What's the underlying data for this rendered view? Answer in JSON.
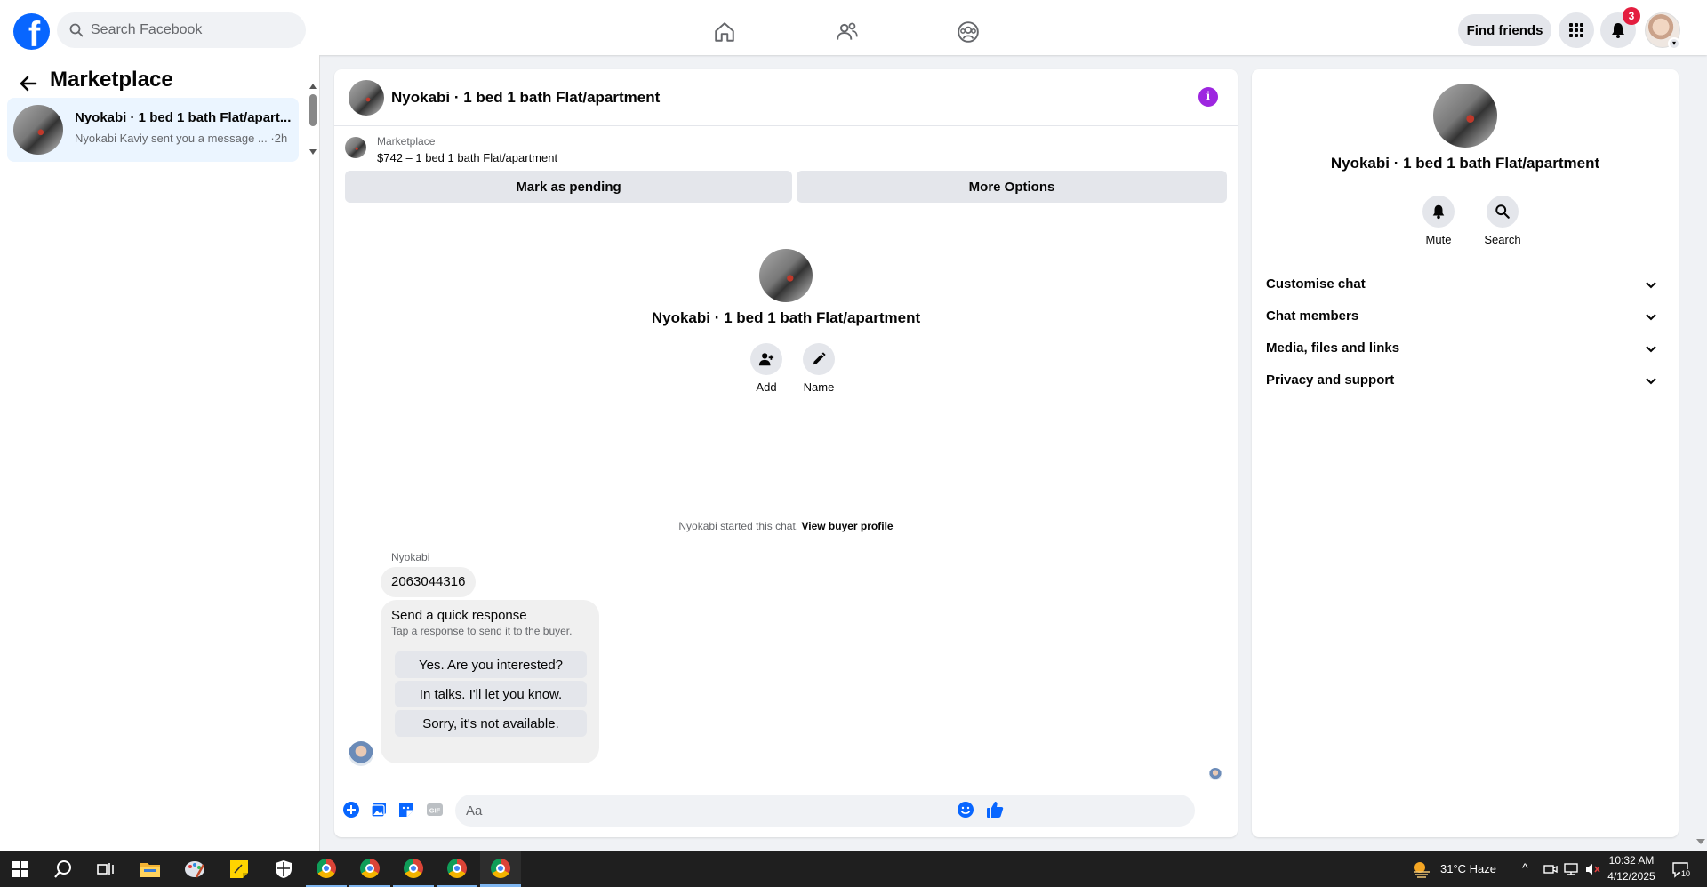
{
  "topbar": {
    "logo": "f",
    "search_placeholder": "Search Facebook",
    "find_friends": "Find friends",
    "notification_count": "3"
  },
  "left": {
    "title": "Marketplace",
    "conversation": {
      "name": "Nyokabi · 1 bed 1 bath Flat/apart...",
      "preview": "Nyokabi Kaviy sent you a message ... ·2h"
    }
  },
  "chat": {
    "header_title": "Nyokabi · 1 bed 1 bath Flat/apartment",
    "listing": {
      "label": "Marketplace",
      "price_line": "$742 – 1 bed 1 bath Flat/apartment"
    },
    "mark_pending": "Mark as pending",
    "more_options": "More Options",
    "center_name": "Nyokabi · 1 bed 1 bath Flat/apartment",
    "actions": {
      "add": "Add",
      "name": "Name"
    },
    "started_text": "Nyokabi started this chat.",
    "view_buyer_profile": "View buyer profile",
    "sender": "Nyokabi",
    "message": "2063044316",
    "quick_response": {
      "title": "Send a quick response",
      "subtitle": "Tap a response to send it to the buyer.",
      "options": [
        "Yes. Are you interested?",
        "In talks. I'll let you know.",
        "Sorry, it's not available."
      ]
    },
    "composer_placeholder": "Aa",
    "gif_label": "GIF"
  },
  "right": {
    "name": "Nyokabi · 1 bed 1 bath Flat/apartment",
    "mute": "Mute",
    "search": "Search",
    "sections": [
      "Customise chat",
      "Chat members",
      "Media, files and links",
      "Privacy and support"
    ]
  },
  "taskbar": {
    "weather": "31°C  Haze",
    "time": "10:32 AM",
    "date": "4/12/2025",
    "notif_count": "10"
  },
  "colors": {
    "facebook_blue": "#0866ff",
    "info_purple": "#9d26e0",
    "badge_red": "#e41e3f",
    "selected_conversation": "#ebf5ff"
  }
}
